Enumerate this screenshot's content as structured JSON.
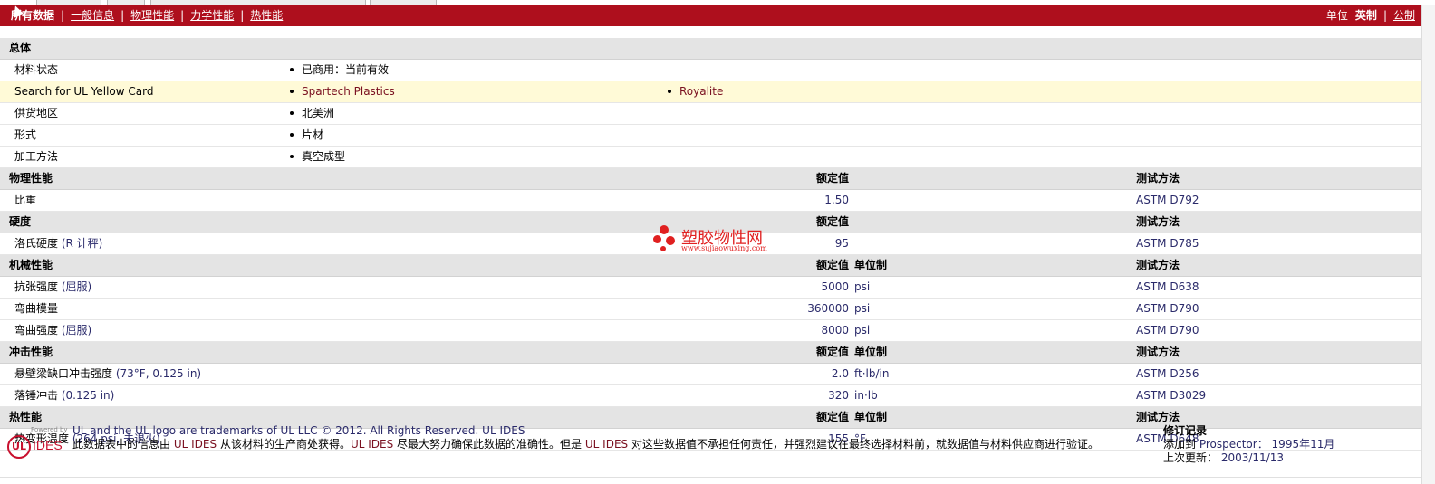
{
  "nav": {
    "items": [
      {
        "label": "所有数据",
        "active": true
      },
      {
        "label": "一般信息",
        "active": false
      },
      {
        "label": "物理性能",
        "active": false
      },
      {
        "label": "力学性能",
        "active": false
      },
      {
        "label": "热性能",
        "active": false
      }
    ],
    "separator": "|"
  },
  "units": {
    "label": "单位",
    "selected": "英制",
    "separator": "|",
    "other": "公制"
  },
  "general": {
    "title": "总体",
    "rows": [
      {
        "label": "材料状态",
        "values": [
          "已商用：当前有效"
        ]
      },
      {
        "label": "Search for UL Yellow Card",
        "values": [
          "Spartech Plastics",
          "Royalite"
        ]
      },
      {
        "label": "供货地区",
        "values": [
          "北美洲"
        ]
      },
      {
        "label": "形式",
        "values": [
          "片材"
        ]
      },
      {
        "label": "加工方法",
        "values": [
          "真空成型"
        ]
      }
    ]
  },
  "sections": [
    {
      "title": "物理性能",
      "nominal_header": "额定值",
      "unit_header": "",
      "test_header": "测试方法",
      "rows": [
        {
          "label": "比重",
          "extra": "",
          "value": "1.50",
          "unit": "",
          "test": "ASTM D792"
        }
      ]
    },
    {
      "title": "硬度",
      "nominal_header": "额定值",
      "unit_header": "",
      "test_header": "测试方法",
      "rows": [
        {
          "label": "洛氏硬度",
          "extra": "(R 计秤)",
          "value": "95",
          "unit": "",
          "test": "ASTM D785"
        }
      ]
    },
    {
      "title": "机械性能",
      "nominal_header": "额定值",
      "unit_header": "单位制",
      "test_header": "测试方法",
      "rows": [
        {
          "label": "抗张强度",
          "extra": "(屈服)",
          "value": "5000",
          "unit": "psi",
          "test": "ASTM D638"
        },
        {
          "label": "弯曲模量",
          "extra": "",
          "value": "360000",
          "unit": "psi",
          "test": "ASTM D790"
        },
        {
          "label": "弯曲强度",
          "extra": "(屈服)",
          "value": "8000",
          "unit": "psi",
          "test": "ASTM D790"
        }
      ]
    },
    {
      "title": "冲击性能",
      "nominal_header": "额定值",
      "unit_header": "单位制",
      "test_header": "测试方法",
      "rows": [
        {
          "label": "悬壁梁缺口冲击强度",
          "extra": "(73°F, 0.125 in)",
          "value": "2.0",
          "unit": "ft·lb/in",
          "test": "ASTM D256"
        },
        {
          "label": "落锤冲击",
          "extra": "(0.125 in)",
          "value": "320",
          "unit": "in·lb",
          "test": "ASTM D3029"
        }
      ]
    },
    {
      "title": "热性能",
      "nominal_header": "额定值",
      "unit_header": "单位制",
      "test_header": "测试方法",
      "rows": [
        {
          "label": "热变形温度",
          "extra": "(264 psi, 未退火)",
          "value": "155",
          "unit": "°F",
          "test": "ASTM D648"
        }
      ]
    }
  ],
  "watermark": {
    "text": "塑胶物性网",
    "url": "www.sujiaowuxing.com"
  },
  "footer": {
    "logo_powered": "Powered by",
    "logo_ul": "UL",
    "logo_ides": "IDES",
    "line1": "UL and the UL logo are trademarks of UL LLC © 2012. All Rights Reserved. UL IDES",
    "line2_a": "此数据表中的信息由",
    "line2_b": "UL IDES",
    "line2_c": "从该材料的生产商处获得。",
    "line2_d": "UL IDES",
    "line2_e": "尽最大努力确保此数据的准确性。但是",
    "line2_f": "UL IDES",
    "line2_g": "对这些数据值不承担任何责任，并强烈建议在最终选择材料前，就数据值与材料供应商进行验证。",
    "revision": {
      "title": "修订记录",
      "added_label": "添加到",
      "added_target": "Prospector：",
      "added_date": "1995年11月",
      "updated_label": "上次更新：",
      "updated_date": "2003/11/13"
    }
  },
  "colors": {
    "header_bar": "#ae0f1d",
    "section_bg": "#e4e4e4",
    "highlight_row": "#fffad7",
    "link": "#7a1020",
    "value_text": "#2a2a6a"
  }
}
